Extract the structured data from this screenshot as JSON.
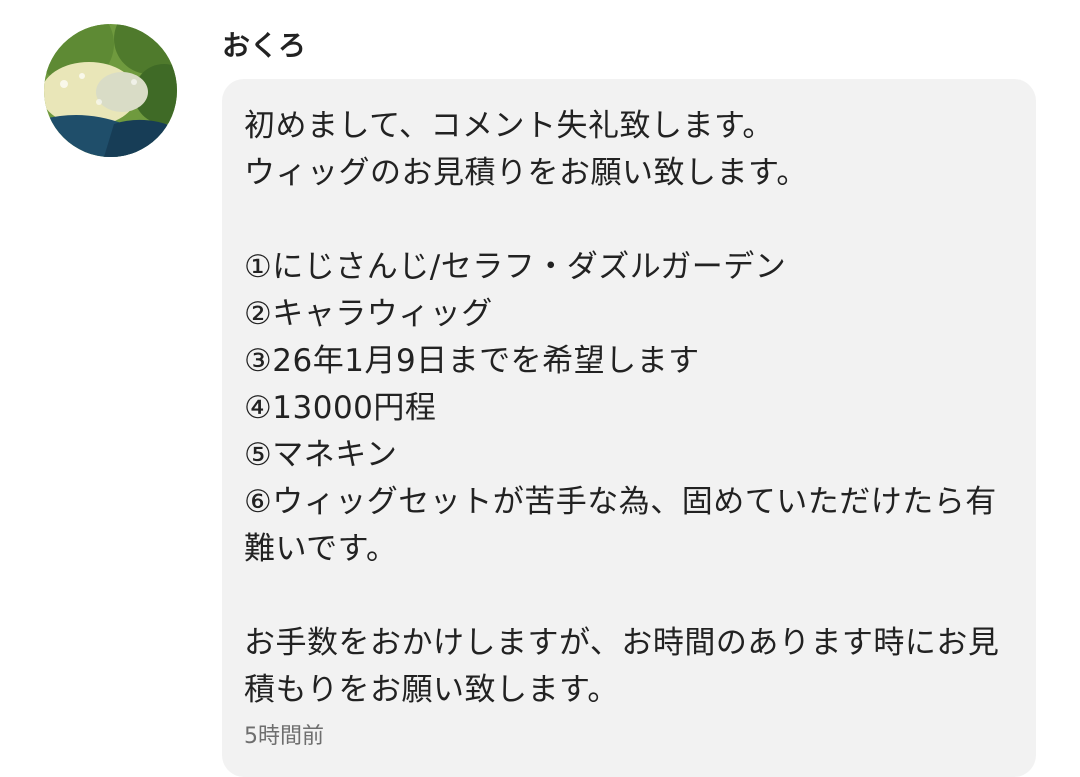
{
  "comment": {
    "username": "おくろ",
    "avatar_icon": "user-avatar-illustration",
    "message": "初めまして、コメント失礼致します。\nウィッグのお見積りをお願い致します。\n\n①にじさんじ/セラフ・ダズルガーデン\n②キャラウィッグ\n③26年1月9日までを希望します\n④13000円程\n⑤マネキン\n⑥ウィッグセットが苦手な為、固めていただけたら有難いです。\n\nお手数をおかけしますが、お時間のあります時にお見積もりをお願い致します。",
    "timestamp": "5時間前"
  },
  "colors": {
    "bubble_background": "#f2f2f2",
    "text": "#222222",
    "timestamp": "#6e6e6e"
  }
}
